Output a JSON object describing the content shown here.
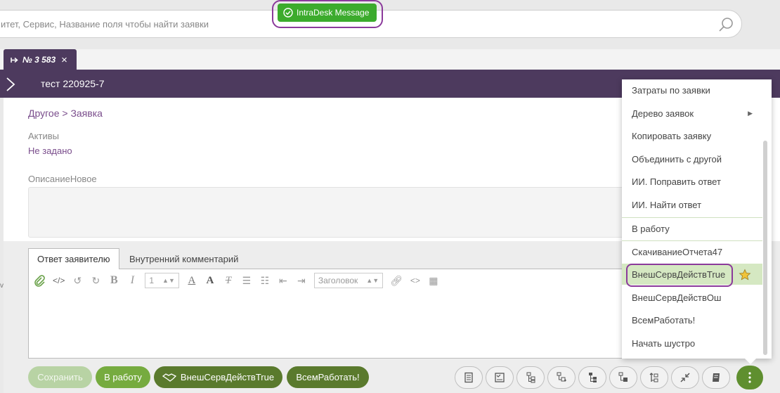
{
  "search": {
    "placeholder": "итет, Сервис, Название поля чтобы найти заявки"
  },
  "notification": {
    "label": "IntraDesk Message"
  },
  "tab": {
    "label": "№ 3 583",
    "close": "×"
  },
  "ticket": {
    "title": "тест 220925-7"
  },
  "breadcrumb": {
    "path": "Другое >",
    "current": "Заявка"
  },
  "fields": {
    "assets": {
      "label": "Активы",
      "value": "Не задано"
    },
    "description": {
      "label": "ОписаниеНовое"
    }
  },
  "reply_tabs": [
    "Ответ заявителю",
    "Внутренний комментарий"
  ],
  "editor": {
    "font_size": "1",
    "heading": "Заголовок"
  },
  "buttons": {
    "save": "Сохранить",
    "work": "В работу",
    "ext": "ВнешСервДействTrue",
    "all": "ВсемРаботать!"
  },
  "menu": [
    {
      "label": "Затраты по заявки"
    },
    {
      "label": "Дерево заявок",
      "submenu": true
    },
    {
      "label": "Копировать заявку"
    },
    {
      "label": "Объединить с другой"
    },
    {
      "label": "ИИ. Поправить ответ"
    },
    {
      "label": "ИИ. Найти ответ"
    },
    {
      "label": "В работу"
    },
    {
      "label": "СкачиваниеОтчета47"
    },
    {
      "label": "ВнешСервДействTrue",
      "highlighted": true
    },
    {
      "label": "ВнешСервДействОш"
    },
    {
      "label": "ВсемРаботать!"
    },
    {
      "label": "Начать шустро"
    }
  ],
  "colors": {
    "header": "#4d3a5e",
    "accent_green": "#5a7a2d",
    "notification_green": "#3cab2d",
    "link_purple": "#7a4d8c",
    "highlight_ring": "#8b3a9b"
  },
  "icons": [
    "search-icon",
    "check-circle-icon",
    "pin-icon",
    "chevron-right-icon",
    "paperclip-icon",
    "star-icon",
    "kebab-icon"
  ]
}
